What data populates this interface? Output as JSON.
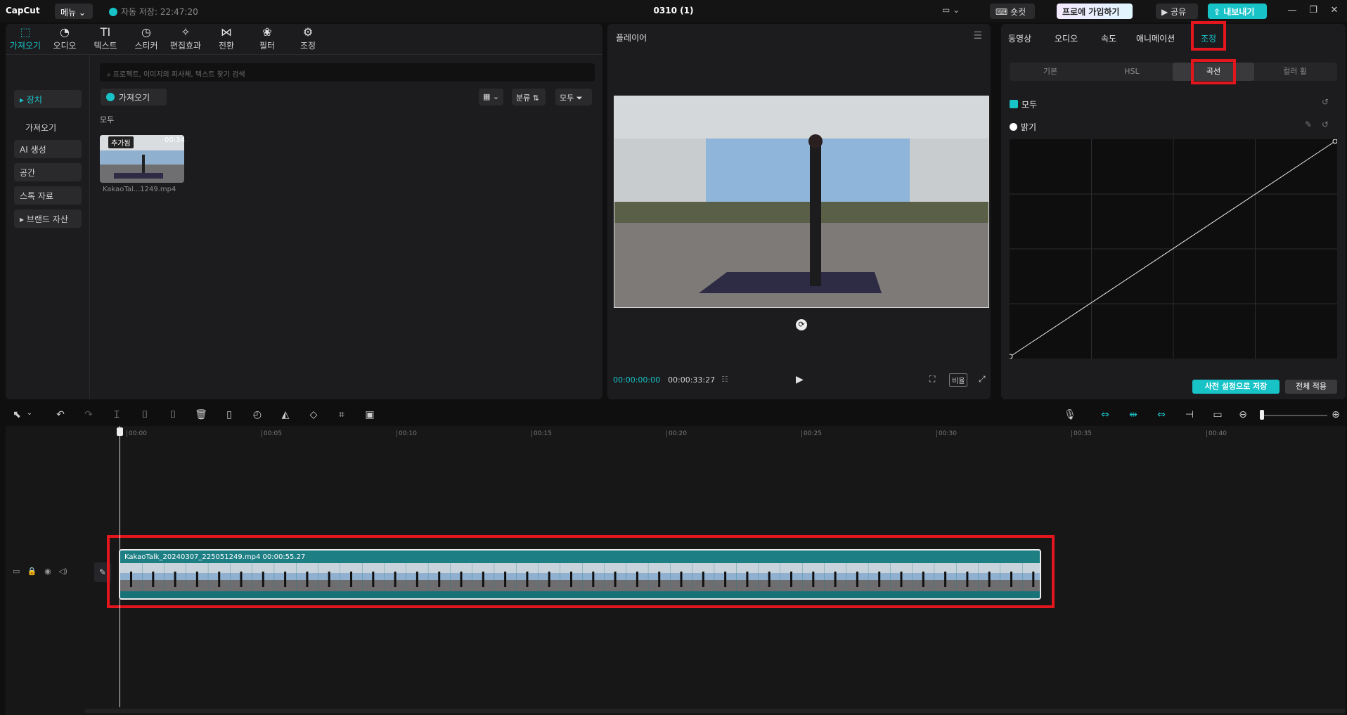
{
  "app": {
    "logo": "CapCut",
    "menu": "메뉴",
    "autosave": "자동 저장: 22:47:20",
    "project_title": "0310 (1)",
    "shortcut": "숏컷",
    "pro": "프로에 가입하기",
    "share": "공유",
    "export": "내보내기",
    "window_controls": [
      "—",
      "❐",
      "✕"
    ]
  },
  "toolbar": {
    "tabs": [
      {
        "label": "가져오기",
        "icon": "import-icon",
        "active": true
      },
      {
        "label": "오디오",
        "icon": "audio-icon"
      },
      {
        "label": "텍스트",
        "icon": "text-icon"
      },
      {
        "label": "스티커",
        "icon": "sticker-icon"
      },
      {
        "label": "편집효과",
        "icon": "effects-icon"
      },
      {
        "label": "전환",
        "icon": "transition-icon"
      },
      {
        "label": "필터",
        "icon": "filter-icon"
      },
      {
        "label": "조정",
        "icon": "adjust-icon"
      }
    ]
  },
  "sidebar": {
    "items": [
      "▸ 장치",
      "가져오기",
      "AI 생성",
      "공간",
      "스톡 자료",
      "▸ 브랜드 자산"
    ]
  },
  "media": {
    "search_placeholder": "프로젝트, 이미지의 피사체, 텍스트 찾기 검색",
    "import_label": "가져오기",
    "sort_label": "분류",
    "filter_label": "모두",
    "all_label": "모두",
    "clip": {
      "added": "추가됨",
      "duration": "00:34",
      "name": "KakaoTal...1249.mp4"
    }
  },
  "player": {
    "title": "플레이어",
    "current_time": "00:00:00:00",
    "total_time": "00:00:33:27",
    "ratio": "비율"
  },
  "inspector": {
    "tabs": [
      "동영상",
      "오디오",
      "속도",
      "애니메이션",
      "조정"
    ],
    "active_tab": "조정",
    "subtabs": [
      "기본",
      "HSL",
      "곡선",
      "컬러 휠"
    ],
    "active_subtab": "곡선",
    "all_label": "모두",
    "brightness_label": "밝기",
    "save_preset": "사전 설정으로 저장",
    "apply_all": "전체 적용",
    "curve": {
      "start": [
        0,
        0
      ],
      "end": [
        1,
        1
      ]
    }
  },
  "timeline": {
    "ruler": [
      "00:00",
      "00:05",
      "00:10",
      "00:15",
      "00:20",
      "00:25",
      "00:30",
      "00:35",
      "00:40"
    ],
    "clip_label": "KakaoTalk_20240307_225051249.mp4   00:00:55.27"
  },
  "colors": {
    "accent": "#18c3c8",
    "highlight": "#e3161d"
  }
}
